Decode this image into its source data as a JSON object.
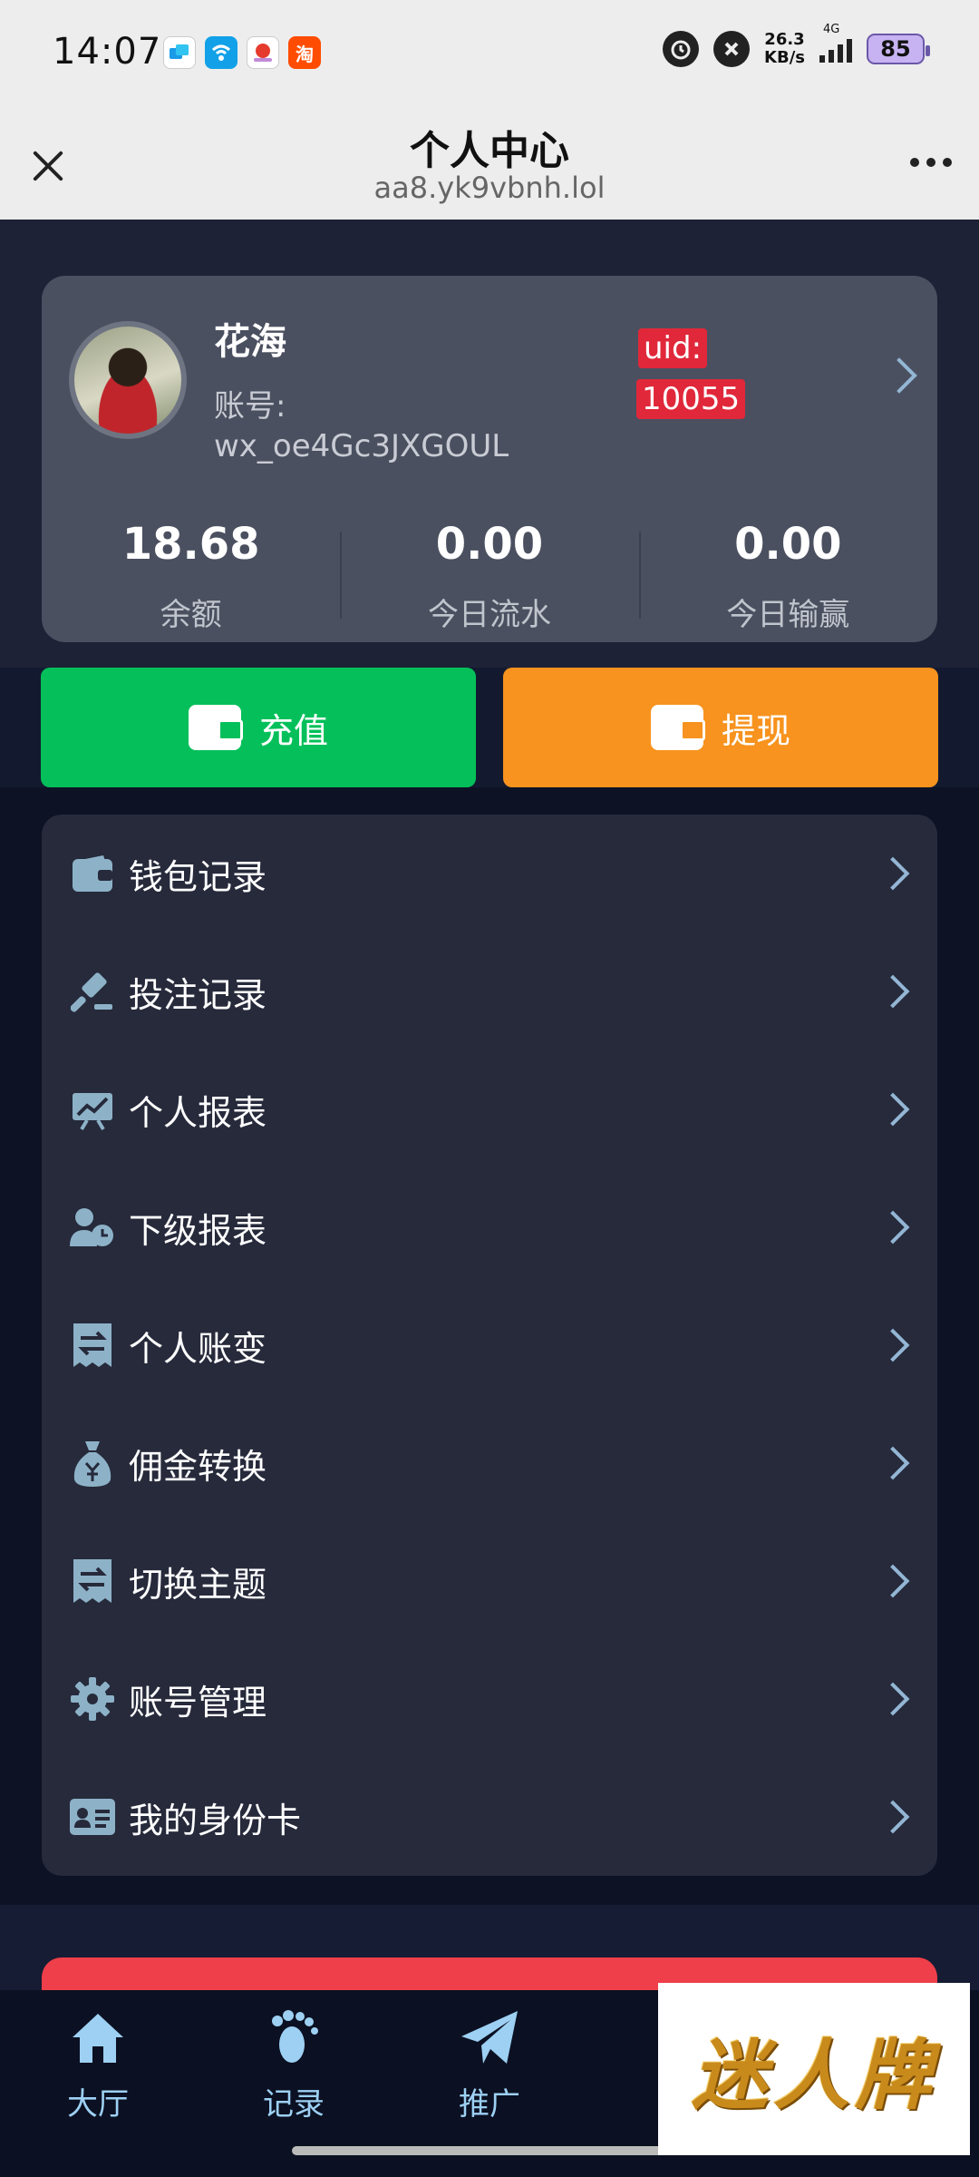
{
  "status_bar": {
    "time": "14:07",
    "apps": [
      "message-app-icon",
      "wifi-key-app-icon",
      "weather-app-icon",
      "taobao-app-icon"
    ],
    "taobao_glyph": "淘",
    "net_speed_value": "26.3",
    "net_speed_unit": "KB/s",
    "network_type": "4G",
    "battery": "85"
  },
  "titlebar": {
    "title": "个人中心",
    "url": "aa8.yk9vbnh.lol"
  },
  "profile": {
    "nickname": "花海",
    "account_label": "账号:",
    "account_value": "wx_oe4Gc3JXGOUL",
    "uid_label": "uid:",
    "uid_value": "10055",
    "stats": [
      {
        "value": "18.68",
        "label": "余额"
      },
      {
        "value": "0.00",
        "label": "今日流水"
      },
      {
        "value": "0.00",
        "label": "今日输赢"
      }
    ]
  },
  "actions": {
    "recharge_label": "充值",
    "withdraw_label": "提现"
  },
  "menu": {
    "items": [
      {
        "label": "钱包记录",
        "icon": "wallet-icon"
      },
      {
        "label": "投注记录",
        "icon": "gavel-icon"
      },
      {
        "label": "个人报表",
        "icon": "chart-board-icon"
      },
      {
        "label": "下级报表",
        "icon": "user-clock-icon"
      },
      {
        "label": "个人账变",
        "icon": "receipt-exchange-icon"
      },
      {
        "label": "佣金转换",
        "icon": "money-bag-icon"
      },
      {
        "label": "切换主题",
        "icon": "receipt-exchange-icon"
      },
      {
        "label": "账号管理",
        "icon": "gear-icon"
      },
      {
        "label": "我的身份卡",
        "icon": "id-card-icon"
      }
    ]
  },
  "tabbar": {
    "tabs": [
      {
        "label": "大厅",
        "icon": "home-icon"
      },
      {
        "label": "记录",
        "icon": "footprints-icon"
      },
      {
        "label": "推广",
        "icon": "paper-plane-icon"
      }
    ]
  },
  "watermark": {
    "text": "迷人牌"
  },
  "colors": {
    "accent_green": "#05c05a",
    "accent_orange": "#f7931e",
    "uid_red": "#e0283a",
    "tab_blue": "#9dd0f3"
  }
}
